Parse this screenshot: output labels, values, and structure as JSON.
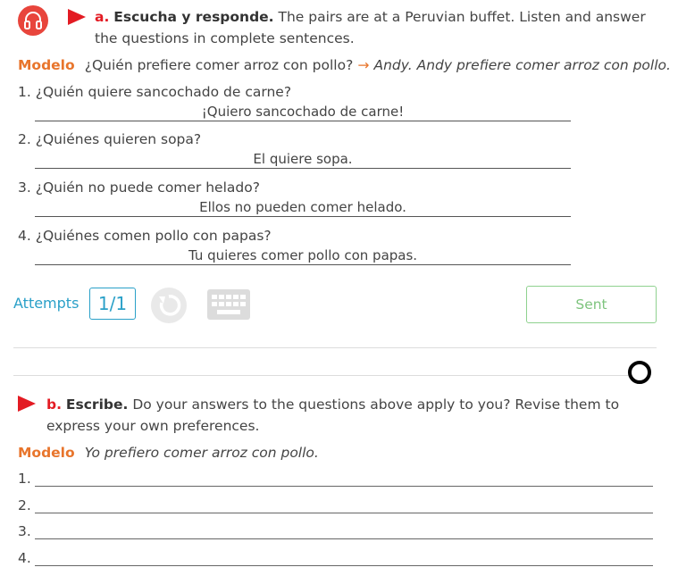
{
  "part_a": {
    "letter": "a.",
    "title": "Escucha y responde.",
    "instruction": " The pairs are at a Peruvian buffet. Listen and answer the questions in complete sentences."
  },
  "modelo_a": {
    "label": "Modelo",
    "question": "¿Quién prefiere comer arroz con pollo?",
    "arrow": "→",
    "answer": "Andy. Andy prefiere comer arroz con pollo."
  },
  "questions": [
    {
      "text": "1. ¿Quién quiere sancochado de carne?",
      "answer": "¡Quiero sancochado de carne!"
    },
    {
      "text": "2. ¿Quiénes quieren sopa?",
      "answer": "El quiere sopa."
    },
    {
      "text": "3. ¿Quién no puede comer helado?",
      "answer": "Ellos no pueden comer helado."
    },
    {
      "text": "4. ¿Quiénes comen pollo con papas?",
      "answer": "Tu quieres comer pollo con papas."
    }
  ],
  "controls": {
    "attempts_label": "Attempts",
    "attempts_value": "1/1",
    "sent_label": "Sent"
  },
  "part_b": {
    "letter": "b.",
    "title": "Escribe.",
    "instruction": " Do your answers to the questions above apply to you? Revise them to express your own preferences."
  },
  "modelo_b": {
    "label": "Modelo",
    "text": "Yo prefiero comer arroz con pollo."
  },
  "write_lines": [
    "1.",
    "2.",
    "3.",
    "4."
  ],
  "colors": {
    "accent_red": "#e31b23",
    "modelo_orange": "#e8752c",
    "attempts_blue": "#2aa0c8",
    "sent_green": "#7ec47e"
  },
  "icons": [
    "headphones-icon",
    "play-icon",
    "reset-icon",
    "keyboard-icon",
    "circle-icon"
  ]
}
